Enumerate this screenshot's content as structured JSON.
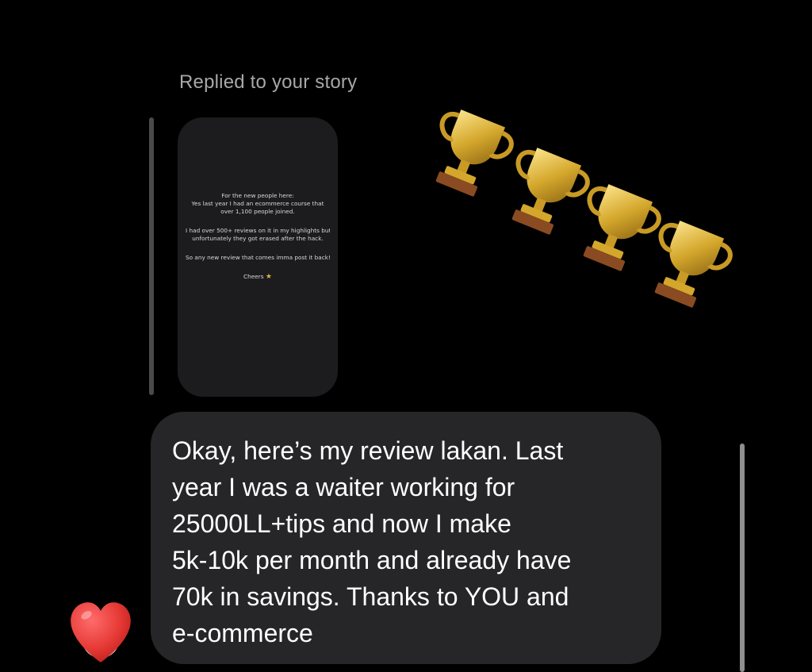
{
  "replied_label": "Replied to your story",
  "story": {
    "lines": [
      "For the new people here:",
      "Yes last year I had an ecommerce course that",
      "over 1,100 people joined.",
      "",
      "I had over 500+ reviews on it in my highlights but",
      "unfortunately they got erased after the hack.",
      "",
      "So any new review that comes imma post it back!",
      "",
      "Cheers"
    ],
    "cheers_icon": "trophy-icon"
  },
  "reaction_icons": [
    "trophy-icon",
    "trophy-icon",
    "trophy-icon",
    "trophy-icon"
  ],
  "message": {
    "lines": [
      "Okay, here’s my review lakan. Last",
      "year I was a waiter working for",
      "25000LL+tips and now I make",
      "5k-10k per month and already have",
      "70k in savings. Thanks to YOU and",
      "e-commerce"
    ]
  },
  "reaction": {
    "icon": "heart-icon",
    "color": "#e53935"
  },
  "colors": {
    "background": "#000000",
    "bubble": "#262628",
    "story_card": "#1c1c1e",
    "gold": "#d4a72c"
  }
}
